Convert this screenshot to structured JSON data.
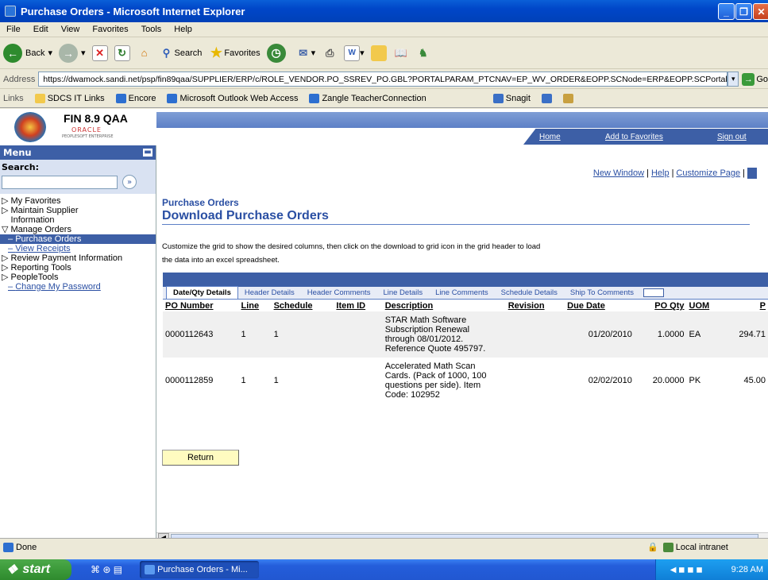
{
  "window": {
    "title": "Purchase Orders - Microsoft Internet Explorer"
  },
  "menubar": [
    "File",
    "Edit",
    "View",
    "Favorites",
    "Tools",
    "Help"
  ],
  "toolbar": {
    "back": "Back",
    "search": "Search",
    "favorites": "Favorites"
  },
  "address": {
    "label": "Address",
    "url": "https://dwamock.sandi.net/psp/fin89qaa/SUPPLIER/ERP/c/ROLE_VENDOR.PO_SSREV_PO.GBL?PORTALPARAM_PTCNAV=EP_WV_ORDER&EOPP.SCNode=ERP&EOPP.SCPortal=SUPPL",
    "go": "Go"
  },
  "links": {
    "label": "Links",
    "items": [
      "SDCS IT Links",
      "Encore",
      "Microsoft Outlook Web Access",
      "Zangle TeacherConnection"
    ],
    "snagit": "Snagit"
  },
  "header": {
    "logo_title": "FIN 8.9 QAA",
    "logo_sub1": "ORACLE",
    "logo_sub2": "PEOPLESOFT ENTERPRISE",
    "home": "Home",
    "add_fav": "Add to Favorites",
    "sign_out": "Sign out"
  },
  "menu": {
    "title": "Menu",
    "search_label": "Search:",
    "items": [
      "My Favorites",
      "Maintain Supplier Information",
      "Manage Orders",
      "Purchase Orders",
      "View Receipts",
      "Review Payment Information",
      "Reporting Tools",
      "PeopleTools",
      "Change My Password"
    ]
  },
  "page": {
    "new_window": "New Window",
    "help": "Help",
    "customize": "Customize Page",
    "section": "Purchase Orders",
    "title": "Download Purchase Orders",
    "instructions1": "Customize the grid to show the desired columns, then click on the download to grid icon in the grid header to load",
    "instructions2": "the data into an excel spreadsheet.",
    "tabs": [
      "Date/Qty Details",
      "Header Details",
      "Header Comments",
      "Line Details",
      "Line Comments",
      "Schedule Details",
      "Ship To Comments"
    ],
    "columns": [
      "PO Number",
      "Line",
      "Schedule",
      "Item ID",
      "Description",
      "Revision",
      "Due Date",
      "PO Qty",
      "UOM",
      "P"
    ],
    "rows": [
      {
        "po": "0000112643",
        "line": "1",
        "schedule": "1",
        "desc1": "STAR Math Software",
        "desc2": "Subscription Renewal",
        "desc3": "through 08/01/2012.",
        "desc4": "Reference Quote 495797.",
        "due": "01/20/2010",
        "qty": "1.0000",
        "uom": "EA",
        "price": "294.71"
      },
      {
        "po": "0000112859",
        "line": "1",
        "schedule": "1",
        "desc1": "Accelerated Math Scan",
        "desc2": "Cards. (Pack of 1000, 100",
        "desc3": "questions per side). Item",
        "desc4": "Code: 102952",
        "due": "02/02/2010",
        "qty": "20.0000",
        "uom": "PK",
        "price": "45.00"
      }
    ],
    "return_btn": "Return"
  },
  "status": {
    "text": "Done",
    "zone": "Local intranet"
  },
  "taskbar": {
    "start": "start",
    "task": "Purchase Orders - Mi...",
    "time": "9:28 AM"
  }
}
